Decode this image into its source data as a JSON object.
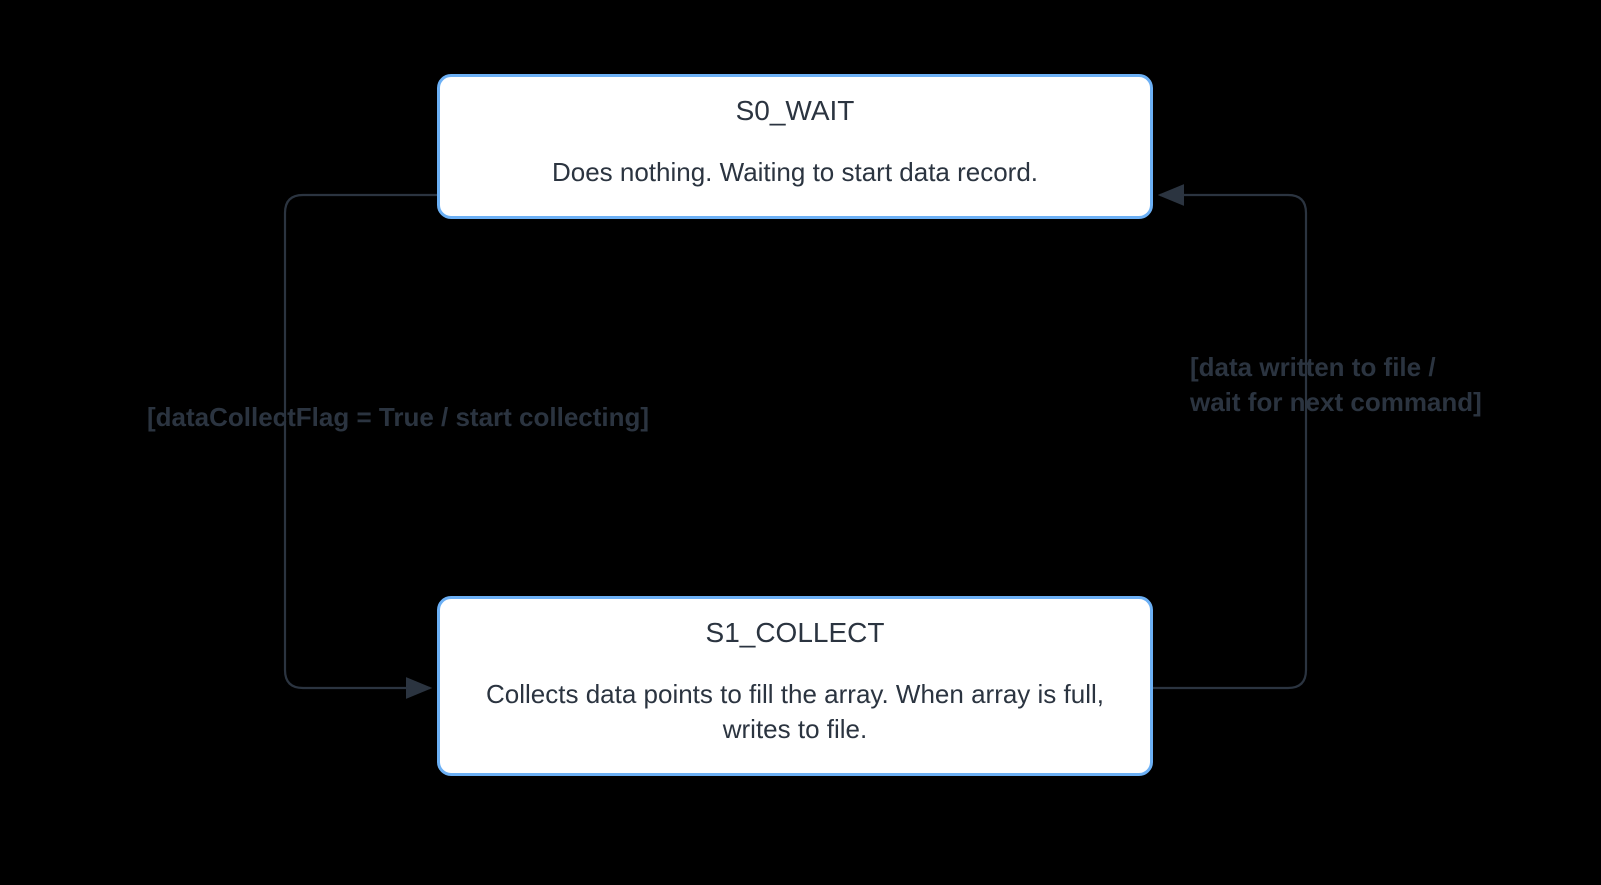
{
  "diagram": {
    "type": "state-machine",
    "states": {
      "s0": {
        "title": "S0_WAIT",
        "description": "Does nothing. Waiting to start data record."
      },
      "s1": {
        "title": "S1_COLLECT",
        "description": "Collects data points to fill the array. When array is full, writes to file."
      }
    },
    "transitions": {
      "s0_to_s1": {
        "label": "[dataCollectFlag = True / start collecting]"
      },
      "s1_to_s0": {
        "line1": "[data written to file /",
        "line2": "wait for next command]"
      }
    }
  }
}
